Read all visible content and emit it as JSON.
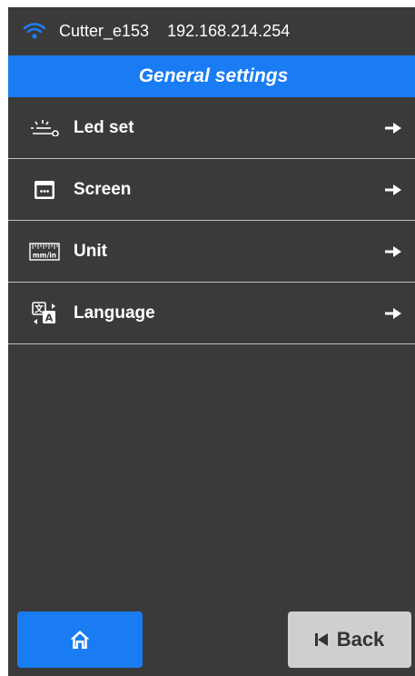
{
  "status": {
    "wifi_icon": "wifi-icon",
    "device_name": "Cutter_e153",
    "ip_address": "192.168.214.254"
  },
  "header": {
    "title": "General settings"
  },
  "menu": {
    "items": [
      {
        "label": "Led set",
        "icon": "led-icon"
      },
      {
        "label": "Screen",
        "icon": "screen-icon"
      },
      {
        "label": "Unit",
        "icon": "ruler-icon"
      },
      {
        "label": "Language",
        "icon": "translate-icon"
      }
    ]
  },
  "footer": {
    "home_icon": "home-icon",
    "back_label": "Back"
  },
  "colors": {
    "accent": "#1a7cf3",
    "background": "#3a3a3a",
    "back_button": "#cfcfcf"
  }
}
